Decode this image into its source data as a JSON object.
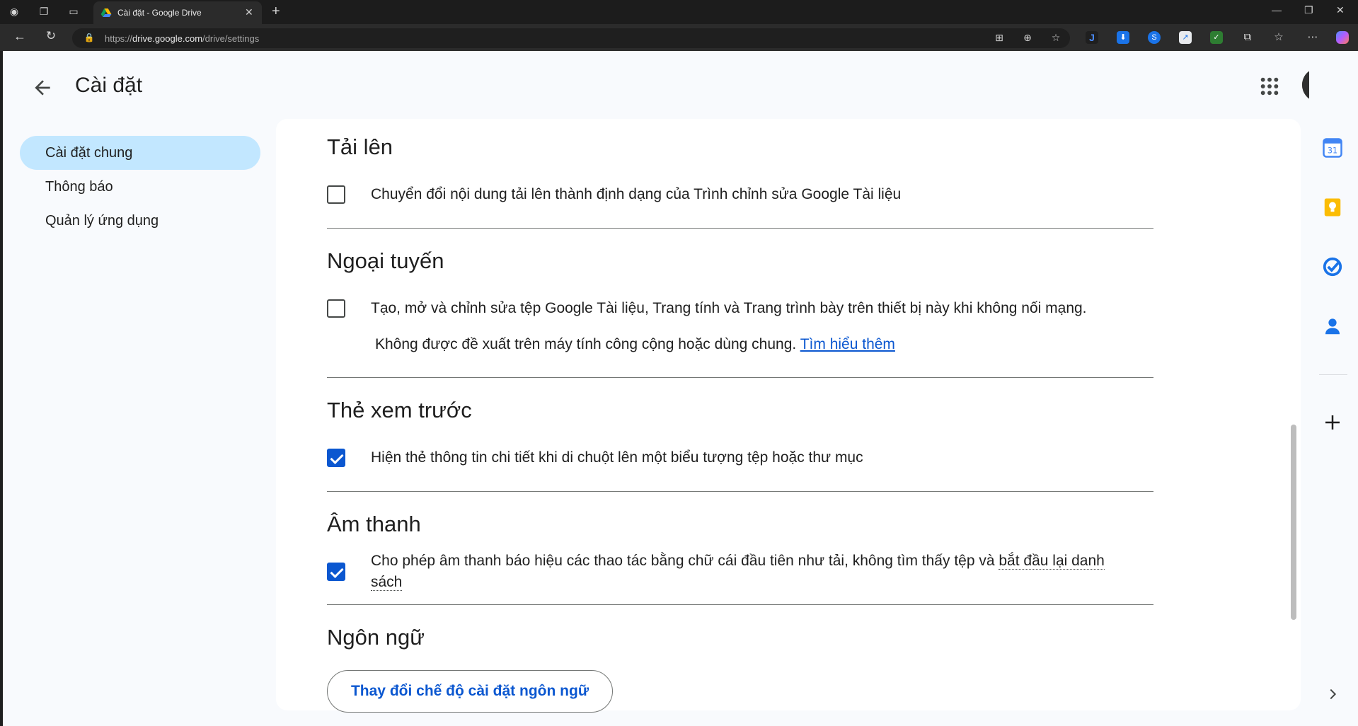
{
  "browser": {
    "tab_title": "Cài đặt - Google Drive",
    "url_prefix": "https://",
    "url_host": "drive.google.com",
    "url_path": "/drive/settings"
  },
  "header": {
    "title": "Cài đặt"
  },
  "sidebar": {
    "items": [
      {
        "label": "Cài đặt chung",
        "active": true
      },
      {
        "label": "Thông báo",
        "active": false
      },
      {
        "label": "Quản lý ứng dụng",
        "active": false
      }
    ]
  },
  "sections": {
    "upload": {
      "title": "Tải lên",
      "option": "Chuyển đổi nội dung tải lên thành định dạng của Trình chỉnh sửa Google Tài liệu",
      "checked": false
    },
    "offline": {
      "title": "Ngoại tuyến",
      "option": "Tạo, mở và chỉnh sửa tệp Google Tài liệu, Trang tính và Trang trình bày trên thiết bị này khi không nối mạng.",
      "note": "Không được đề xuất trên máy tính công cộng hoặc dùng chung.",
      "link": "Tìm hiểu thêm",
      "checked": false
    },
    "preview": {
      "title": "Thẻ xem trước",
      "option": "Hiện thẻ thông tin chi tiết khi di chuột lên một biểu tượng tệp hoặc thư mục",
      "checked": true
    },
    "sound": {
      "title": "Âm thanh",
      "option_start": "Cho phép âm thanh báo hiệu các thao tác bằng chữ cái đầu tiên như tải, không tìm thấy tệp và",
      "option_term_1": "bắt đầu lại danh",
      "option_term_2": "sách",
      "checked": true
    },
    "language": {
      "title": "Ngôn ngữ",
      "button": "Thay đổi chế độ cài đặt ngôn ngữ"
    }
  },
  "colors": {
    "accent": "#0b57d0",
    "nav_active": "#c2e7ff",
    "page_bg": "#f8fafd"
  }
}
